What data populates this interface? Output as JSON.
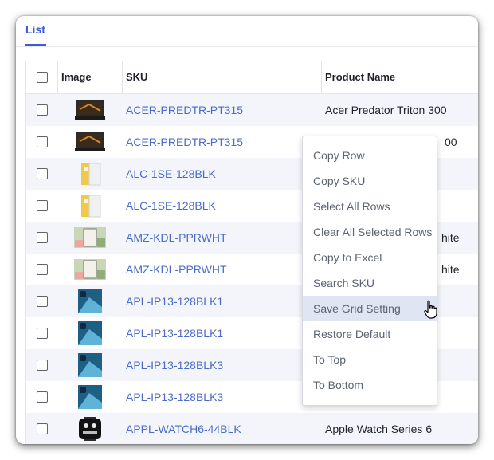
{
  "tabs": {
    "active": "List"
  },
  "table": {
    "columns": {
      "image": "Image",
      "sku": "SKU",
      "product_name": "Product Name"
    },
    "rows": [
      {
        "sku": "ACER-PREDTR-PT315",
        "product_name": "Acer Predator Triton 300",
        "image_icon": "laptop-icon"
      },
      {
        "sku": "ACER-PREDTR-PT315",
        "product_name": "00",
        "image_icon": "laptop-icon"
      },
      {
        "sku": "ALC-1SE-128BLK",
        "product_name": "",
        "image_icon": "phone-package-icon"
      },
      {
        "sku": "ALC-1SE-128BLK",
        "product_name": "",
        "image_icon": "phone-package-icon"
      },
      {
        "sku": "AMZ-KDL-PPRWHT",
        "product_name": "hite",
        "image_icon": "ereader-icon"
      },
      {
        "sku": "AMZ-KDL-PPRWHT",
        "product_name": "hite",
        "image_icon": "ereader-icon"
      },
      {
        "sku": "APL-IP13-128BLK1",
        "product_name": "",
        "image_icon": "smartphone-icon"
      },
      {
        "sku": "APL-IP13-128BLK1",
        "product_name": "",
        "image_icon": "smartphone-icon"
      },
      {
        "sku": "APL-IP13-128BLK3",
        "product_name": "",
        "image_icon": "smartphone-icon"
      },
      {
        "sku": "APL-IP13-128BLK3",
        "product_name": "",
        "image_icon": "smartphone-icon"
      },
      {
        "sku": "APPL-WATCH6-44BLK",
        "product_name": "Apple Watch Series 6",
        "image_icon": "smartwatch-icon"
      }
    ]
  },
  "context_menu": {
    "items": [
      {
        "label": "Copy Row"
      },
      {
        "label": "Copy SKU"
      },
      {
        "label": "Select All Rows"
      },
      {
        "label": "Clear All Selected Rows"
      },
      {
        "label": "Copy to Excel"
      },
      {
        "label": "Search SKU"
      },
      {
        "label": "Save Grid Setting"
      },
      {
        "label": "Restore Default"
      },
      {
        "label": "To Top"
      },
      {
        "label": "To Bottom"
      }
    ],
    "hovered": "Save Grid Setting"
  },
  "colors": {
    "accent": "#3b5bdb",
    "link": "#4a6cc8",
    "row_alt": "#f3f5fb",
    "menu_hover": "#dfe5f3"
  }
}
